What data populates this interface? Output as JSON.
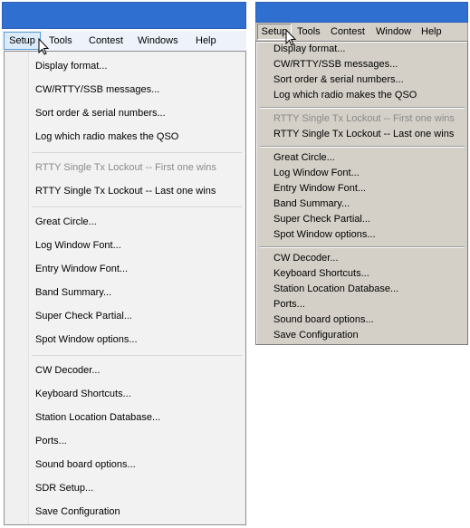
{
  "left": {
    "menubar": [
      "Setup",
      "Tools",
      "Contest",
      "Windows",
      "Help"
    ],
    "items": [
      "Display format...",
      "CW/RTTY/SSB messages...",
      "Sort order & serial numbers...",
      "Log which radio makes the QSO",
      "RTTY Single Tx Lockout -- First one wins",
      "RTTY Single Tx Lockout -- Last one wins",
      "Great Circle...",
      "Log Window Font...",
      "Entry Window Font...",
      "Band Summary...",
      "Super Check Partial...",
      "Spot Window options...",
      "CW Decoder...",
      "Keyboard Shortcuts...",
      "Station Location Database...",
      "Ports...",
      "Sound board options...",
      "SDR Setup...",
      "Save Configuration"
    ]
  },
  "right": {
    "menubar": [
      "Setup",
      "Tools",
      "Contest",
      "Window",
      "Help"
    ],
    "items": [
      "Display format...",
      "CW/RTTY/SSB messages...",
      "Sort order & serial numbers...",
      "Log which radio makes the QSO",
      "RTTY Single Tx Lockout -- First one wins",
      "RTTY Single Tx Lockout -- Last one wins",
      "Great Circle...",
      "Log Window Font...",
      "Entry Window Font...",
      "Band Summary...",
      "Super Check Partial...",
      "Spot Window options...",
      "CW Decoder...",
      "Keyboard Shortcuts...",
      "Station Location Database...",
      "Ports...",
      "Sound board options...",
      "Save Configuration"
    ]
  },
  "colors": {
    "titlebar": "#2f6fd0",
    "modern_menubar": "#eef3fb",
    "modern_highlight": "#dcebfa",
    "classic_face": "#d4d0c8",
    "disabled_text": "#8a8a8a"
  }
}
